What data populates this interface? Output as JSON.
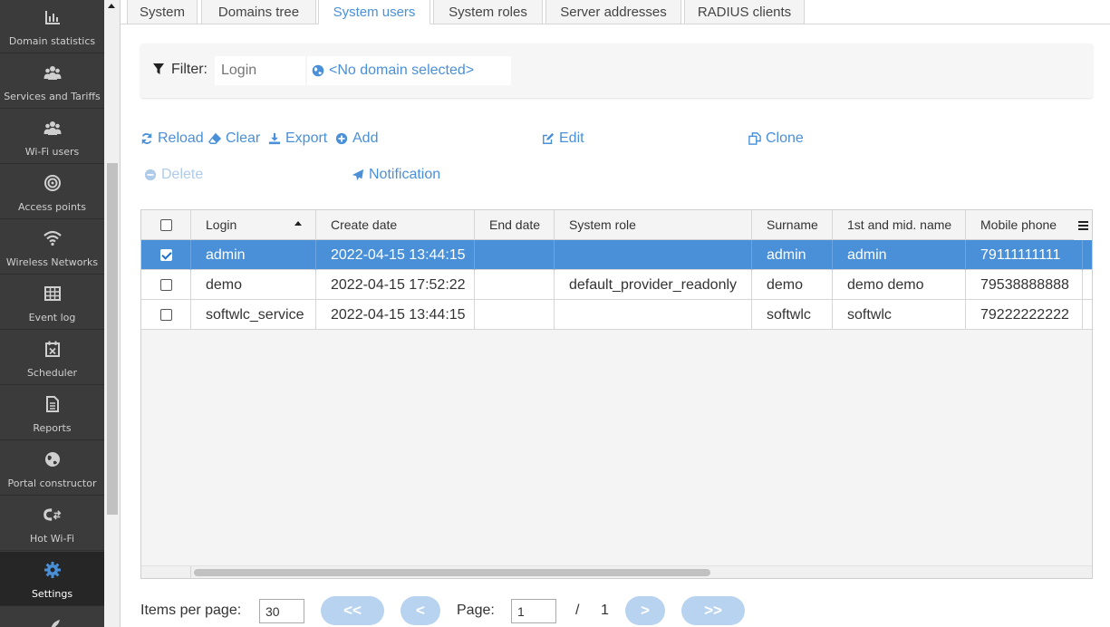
{
  "sidebar": {
    "items": [
      {
        "label": "Domain statistics",
        "icon": "bar-chart-icon"
      },
      {
        "label": "Services and Tariffs",
        "icon": "users-group-icon"
      },
      {
        "label": "Wi-Fi users",
        "icon": "users-group-icon"
      },
      {
        "label": "Access points",
        "icon": "target-icon"
      },
      {
        "label": "Wireless Networks",
        "icon": "wifi-icon"
      },
      {
        "label": "Event log",
        "icon": "table-icon"
      },
      {
        "label": "Scheduler",
        "icon": "calendar-x-icon"
      },
      {
        "label": "Reports",
        "icon": "document-icon"
      },
      {
        "label": "Portal constructor",
        "icon": "globe-icon"
      },
      {
        "label": "Hot Wi-Fi",
        "icon": "magnet-icon"
      },
      {
        "label": "Settings",
        "icon": "gear-icon"
      }
    ],
    "active_color": "#4a90d9"
  },
  "tabs": [
    {
      "label": "System"
    },
    {
      "label": "Domains tree"
    },
    {
      "label": "System users"
    },
    {
      "label": "System roles"
    },
    {
      "label": "Server addresses"
    },
    {
      "label": "RADIUS clients"
    }
  ],
  "active_tab": "System users",
  "filter": {
    "label": "Filter:",
    "login_placeholder": "Login",
    "domain_text": "<No domain selected>"
  },
  "toolbar": {
    "reload": "Reload",
    "clear": "Clear",
    "export": "Export",
    "add": "Add",
    "edit": "Edit",
    "clone": "Clone",
    "delete": "Delete",
    "notification": "Notification"
  },
  "table": {
    "columns": [
      "Login",
      "Create date",
      "End date",
      "System role",
      "Surname",
      "1st and mid. name",
      "Mobile phone"
    ],
    "sort_column": "Login",
    "rows": [
      {
        "selected": true,
        "login": "admin",
        "create_date": "2022-04-15 13:44:15",
        "end_date": "",
        "role": "",
        "surname": "admin",
        "name": "admin",
        "phone": "79111111111"
      },
      {
        "selected": false,
        "login": "demo",
        "create_date": "2022-04-15 17:52:22",
        "end_date": "",
        "role": "default_provider_readonly",
        "surname": "demo",
        "name": "demo demo",
        "phone": "79538888888"
      },
      {
        "selected": false,
        "login": "softwlc_service",
        "create_date": "2022-04-15 13:44:15",
        "end_date": "",
        "role": "",
        "surname": "softwlc",
        "name": "softwlc",
        "phone": "79222222222"
      }
    ]
  },
  "pager": {
    "items_label": "Items per page:",
    "items_value": "30",
    "first": "<<",
    "prev": "<",
    "page_label": "Page:",
    "page_value": "1",
    "separator": "/",
    "total_pages": "1",
    "next": ">",
    "last": ">>"
  },
  "colors": {
    "accent": "#4a90d9",
    "sidebar_bg": "#3b3b3b",
    "selected_row": "#4a90d9"
  }
}
